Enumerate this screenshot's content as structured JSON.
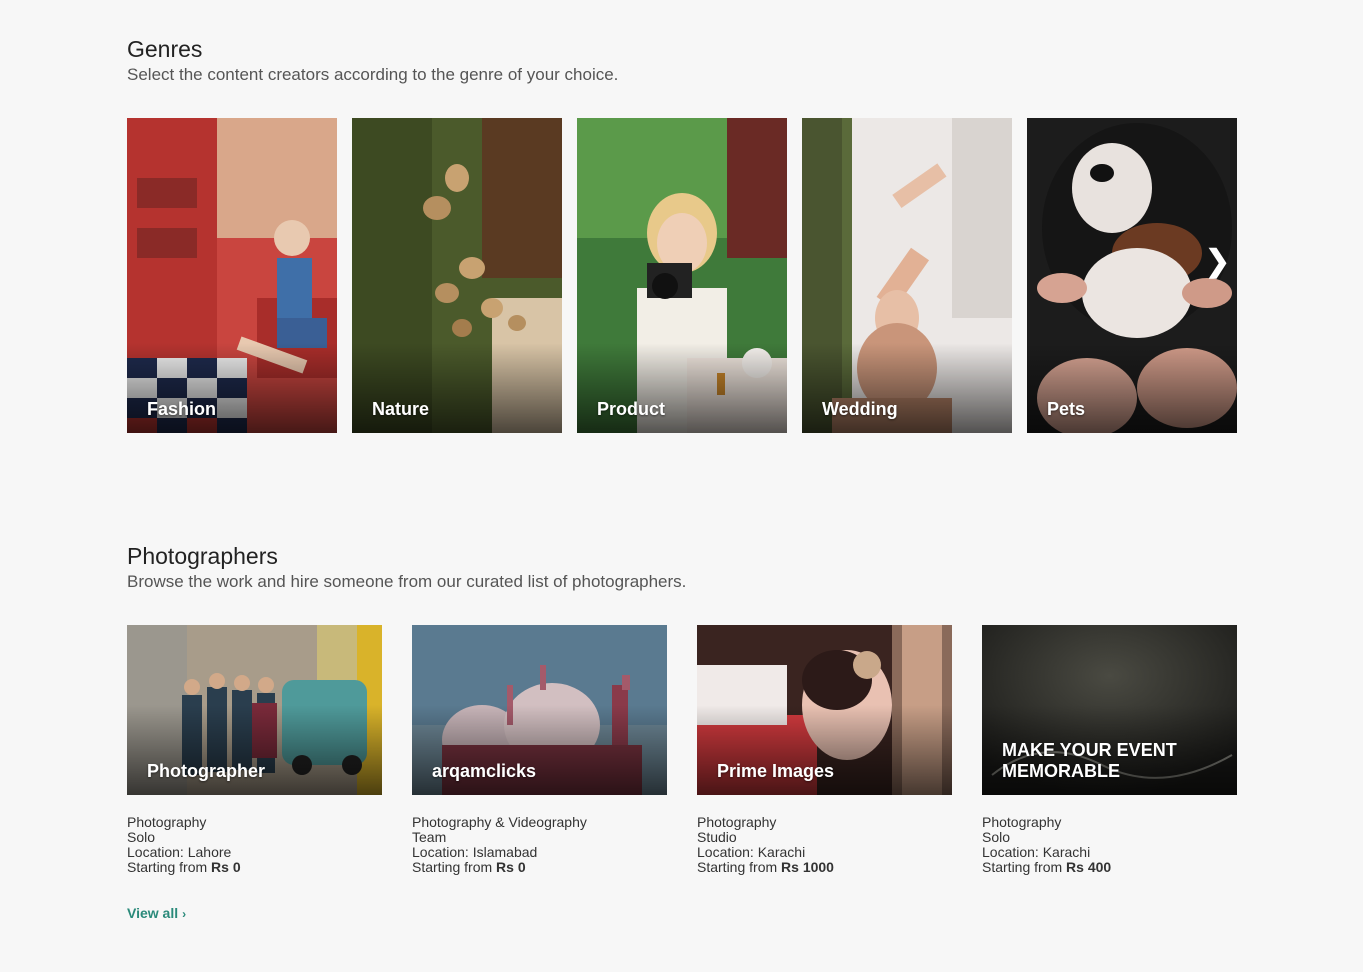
{
  "genres": {
    "title": "Genres",
    "subtitle": "Select the content creators according to the genre of your choice.",
    "items": [
      {
        "label": "Fashion"
      },
      {
        "label": "Nature"
      },
      {
        "label": "Product"
      },
      {
        "label": "Wedding"
      },
      {
        "label": "Pets"
      }
    ],
    "next_icon": "chevron-right-icon"
  },
  "photographers": {
    "title": "Photographers",
    "subtitle": "Browse the work and hire someone from our curated list of photographers.",
    "items": [
      {
        "name": "Photographer",
        "category": "Photography",
        "type": "Solo",
        "location": "Location: Lahore",
        "starting_prefix": "Starting from",
        "price": "Rs 0"
      },
      {
        "name": "arqamclicks",
        "category": "Photography & Videography",
        "type": "Team",
        "location": "Location: Islamabad",
        "starting_prefix": "Starting from",
        "price": "Rs 0"
      },
      {
        "name": "Prime Images",
        "category": "Photography",
        "type": "Studio",
        "location": "Location: Karachi",
        "starting_prefix": "Starting from",
        "price": "Rs 1000"
      },
      {
        "name": "MAKE YOUR EVENT MEMORABLE",
        "category": "Photography",
        "type": "Solo",
        "location": "Location: Karachi",
        "starting_prefix": "Starting from",
        "price": "Rs 400"
      }
    ],
    "view_all": "View all",
    "view_all_icon": "chevron-right-icon"
  },
  "colors": {
    "background": "#f7f7f7",
    "accent": "#2a8a7a"
  }
}
